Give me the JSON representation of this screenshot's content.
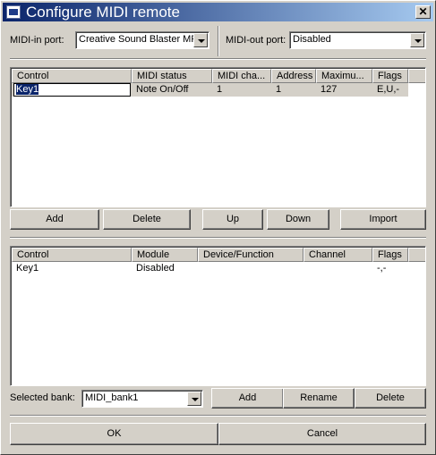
{
  "window": {
    "title": "Configure MIDI remote",
    "close_glyph": "✕"
  },
  "midi_in": {
    "label": "MIDI-in port:",
    "value": "Creative Sound Blaster MP"
  },
  "midi_out": {
    "label": "MIDI-out port:",
    "value": "Disabled"
  },
  "controls_table": {
    "columns": [
      "Control",
      "MIDI status",
      "MIDI cha...",
      "Address",
      "Maximu...",
      "Flags"
    ],
    "rows": [
      {
        "control": "Key1",
        "midi_status": "Note On/Off",
        "channel": "1",
        "address": "1",
        "maximum": "127",
        "flags": "E,U,-"
      }
    ]
  },
  "controls_buttons": {
    "add": "Add",
    "delete": "Delete",
    "up": "Up",
    "down": "Down",
    "import": "Import"
  },
  "mapping_table": {
    "columns": [
      "Control",
      "Module",
      "Device/Function",
      "Channel",
      "Flags"
    ],
    "rows": [
      {
        "control": "Key1",
        "module": "Disabled",
        "device_function": "",
        "channel": "",
        "flags": "-,-"
      }
    ]
  },
  "bank": {
    "label": "Selected bank:",
    "value": "MIDI_bank1",
    "add": "Add",
    "rename": "Rename",
    "delete": "Delete"
  },
  "footer": {
    "ok": "OK",
    "cancel": "Cancel"
  }
}
